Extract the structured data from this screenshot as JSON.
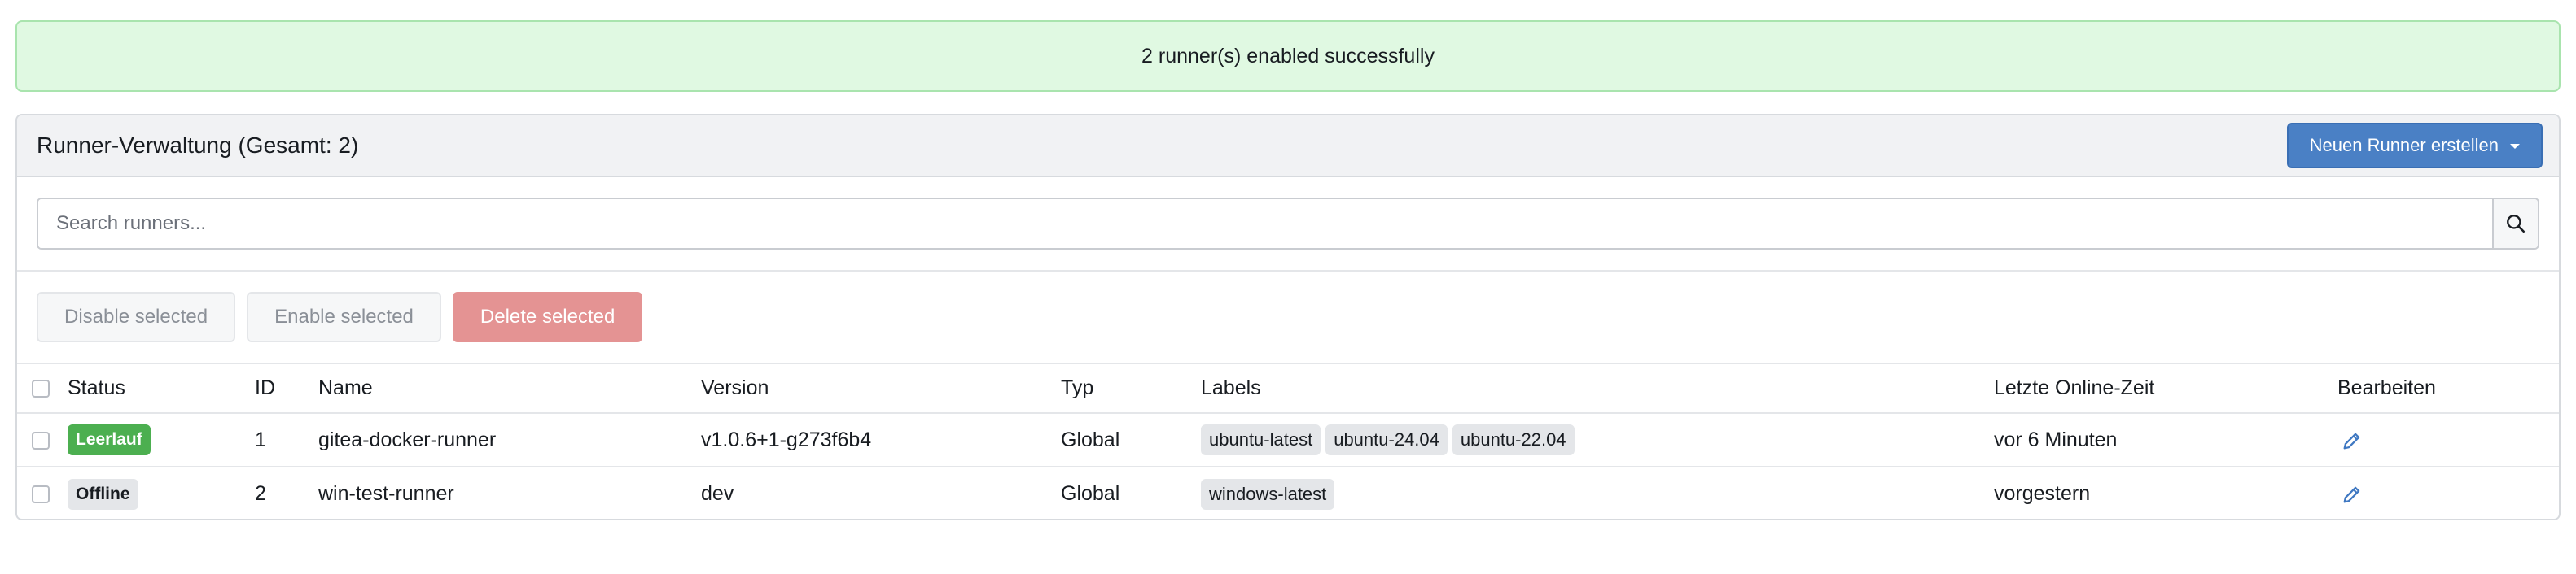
{
  "flash": {
    "message": "2 runner(s) enabled successfully"
  },
  "panel": {
    "title": "Runner-Verwaltung (Gesamt: 2)",
    "new_runner_label": "Neuen Runner erstellen"
  },
  "search": {
    "placeholder": "Search runners..."
  },
  "actions": {
    "disable_label": "Disable selected",
    "enable_label": "Enable selected",
    "delete_label": "Delete selected"
  },
  "table": {
    "headers": {
      "status": "Status",
      "id": "ID",
      "name": "Name",
      "version": "Version",
      "type": "Typ",
      "labels": "Labels",
      "last_online": "Letzte Online-Zeit",
      "edit": "Bearbeiten"
    },
    "rows": [
      {
        "status": "Leerlauf",
        "id": "1",
        "name": "gitea-docker-runner",
        "version": "v1.0.6+1-g273f6b4",
        "type": "Global",
        "labels": [
          "ubuntu-latest",
          "ubuntu-24.04",
          "ubuntu-22.04"
        ],
        "last_online": "vor 6 Minuten"
      },
      {
        "status": "Offline",
        "id": "2",
        "name": "win-test-runner",
        "version": "dev",
        "type": "Global",
        "labels": [
          "windows-latest"
        ],
        "last_online": "vorgestern"
      }
    ]
  },
  "colors": {
    "flash_bg": "#e0f9e2",
    "primary": "#4a80c5",
    "danger": "#e49393",
    "status_idle": "#4caf50",
    "status_offline": "#e4e6e9"
  },
  "icons": {
    "search": "search-icon",
    "edit": "pencil-icon",
    "dropdown": "chevron-down-icon"
  }
}
